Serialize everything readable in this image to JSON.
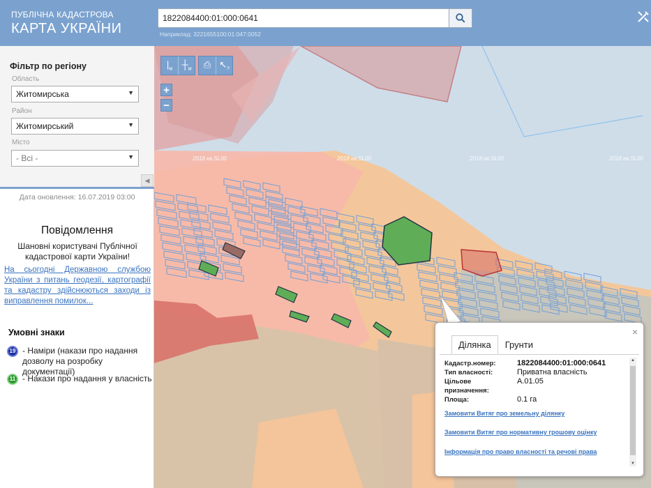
{
  "header": {
    "brand_small": "ПУБЛІЧНА КАДАСТРОВА",
    "brand_big": "КАРТА УКРАЇНИ",
    "search_value": "1822084400:01:000:0641",
    "search_hint": "Наприклад: 3221655100:01:047:0052",
    "search_icon": "search-icon",
    "tools_icon": "tools-icon"
  },
  "filter": {
    "title": "Фільтр по регіону",
    "region_label": "Область",
    "region_value": "Житомирська",
    "district_label": "Район",
    "district_value": "Житомирський",
    "city_label": "Місто",
    "city_value": "- Всі -"
  },
  "updated": "Дата оновлення: 16.07.2019 03:00",
  "messages": {
    "title": "Повідомлення",
    "text": "Шановні користувачі Публічної кадастрової карти України!",
    "link": "На сьогодні Державною службою України з питань геодезії, картографії та кадастру здійснюються заходи із виправлення помилок..."
  },
  "legend": {
    "title": "Умовні знаки",
    "items": [
      {
        "badge": "19",
        "color": "#1a2fa8",
        "text": "- Наміри (накази про надання дозволу на розробку документації)"
      },
      {
        "badge": "11",
        "color": "#2a9a2a",
        "text": "- Накази про надання у власність"
      }
    ]
  },
  "map": {
    "toolbar": [
      "ruler-icon",
      "area-ruler-icon",
      "print-icon",
      "identify-icon"
    ],
    "toolbar_sub": [
      "м",
      "м",
      "",
      "?"
    ],
    "zoom_in": "+",
    "zoom_out": "−",
    "watermarks": [
      "2018 кв.SL00",
      "2018 кв.SL00",
      "2018 кв.SL00",
      "2018 кв.SL00"
    ],
    "colors": {
      "water": "#cfdde9",
      "sand": "#f3c79b",
      "pink": "#f7b8aa",
      "parcel_green": "#5fae57",
      "parcel_red": "#d8736a"
    }
  },
  "popup": {
    "close": "×",
    "tabs": [
      "Ділянка",
      "Грунти"
    ],
    "rows": [
      {
        "k": "Кадастр.номер:",
        "v": "1822084400:01:000:0641"
      },
      {
        "k": "Тип власності:",
        "v": "Приватна власність"
      },
      {
        "k": "Цільове призначення:",
        "v": "А.01.05"
      },
      {
        "k": "Площа:",
        "v": "0.1 га"
      }
    ],
    "links": [
      "Замовити Витяг про земельну ділянку",
      "Замовити Витяг про нормативну грошову оцінку",
      "Інформація про право власності та речові права"
    ]
  }
}
